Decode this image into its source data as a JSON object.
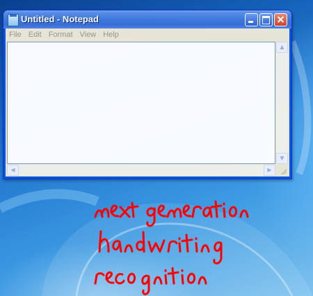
{
  "window": {
    "title": "Untitled - Notepad"
  },
  "menubar": {
    "items": [
      "File",
      "Edit",
      "Format",
      "View",
      "Help"
    ]
  },
  "editor": {
    "content": ""
  },
  "handwriting": {
    "lines": [
      "next generation",
      "handwriting",
      "recognition"
    ],
    "ink_color": "#ff0000"
  },
  "icons": {
    "app": "notepad-icon",
    "minimize": "minimize-icon",
    "maximize": "maximize-icon",
    "close": "close-icon",
    "scroll_up": "scroll-up-arrow-icon",
    "scroll_down": "scroll-down-arrow-icon",
    "scroll_left": "scroll-left-arrow-icon",
    "scroll_right": "scroll-right-arrow-icon",
    "resize_grip": "resize-grip-icon"
  }
}
